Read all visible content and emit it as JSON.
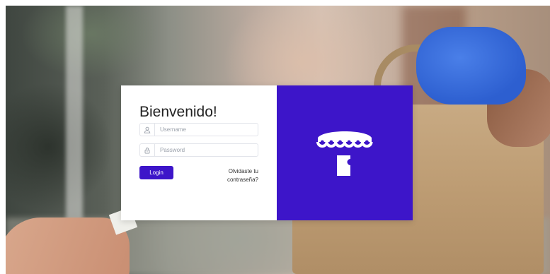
{
  "login": {
    "title": "Bienvenido!",
    "username_placeholder": "Username",
    "password_placeholder": "Password",
    "login_label": "Login",
    "forgot_line1": "Olvidaste tu",
    "forgot_line2": "contraseña?"
  },
  "icons": {
    "username": "user-icon",
    "password": "lock-icon",
    "logo": "storefront-awning-logo"
  },
  "colors": {
    "brand": "#3d15c9",
    "card_left": "#ffffff",
    "text": "#222222"
  }
}
